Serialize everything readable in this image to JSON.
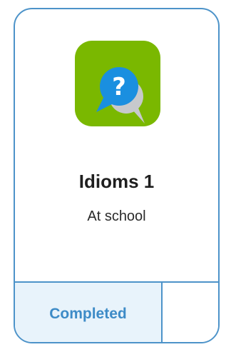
{
  "card": {
    "title": "Idioms 1",
    "subtitle": "At school",
    "status": "Completed",
    "icon": "question-chat-icon"
  },
  "colors": {
    "border": "#4d93c9",
    "tile": "#7ab800",
    "bubble_front": "#1a8fe0",
    "bubble_back": "#c7c9cc",
    "status_bg": "#e8f3fb",
    "status_text": "#3d8bc7"
  }
}
